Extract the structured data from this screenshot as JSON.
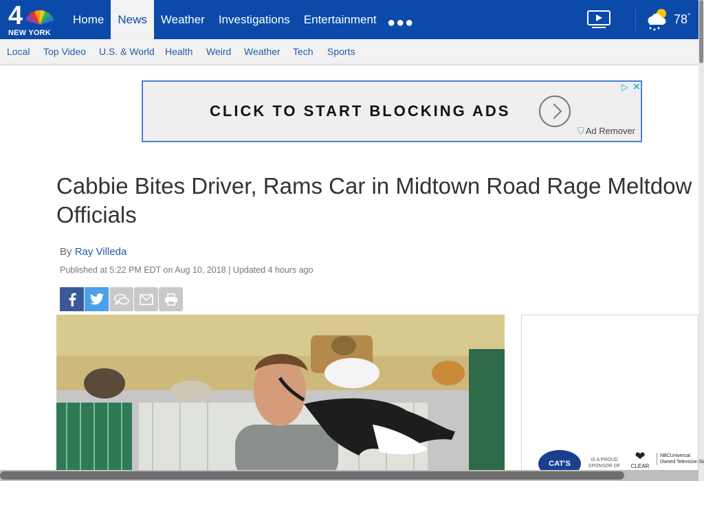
{
  "header": {
    "logo_number": "4",
    "logo_city": "NEW YORK",
    "nav": [
      "Home",
      "News",
      "Weather",
      "Investigations",
      "Entertainment"
    ],
    "active_nav": "News",
    "more_icon": "more-dots-icon",
    "video_icon": "video-play-icon",
    "weather_icon": "partly-cloudy-rain-icon",
    "temperature": "78",
    "temperature_unit": "°"
  },
  "subnav": [
    "Local",
    "Top Video",
    "U.S. & World",
    "Health",
    "Weird",
    "Weather",
    "Tech",
    "Sports"
  ],
  "ad": {
    "text": "CLICK TO START BLOCKING ADS",
    "remover_label": "Ad Remover",
    "choices_icon": "ad-choices-icon",
    "close_icon": "close-icon"
  },
  "article": {
    "headline_line1": "Cabbie Bites Driver, Rams Car in Midtown Road Rage Meltdow",
    "headline_line2": "Officials",
    "by_prefix": "By",
    "author": "Ray Villeda",
    "published": "Published at 5:22 PM EDT on Aug 10, 2018 | Updated 4 hours ago",
    "share_buttons": [
      "facebook-icon",
      "twitter-icon",
      "comments-icon",
      "email-icon",
      "print-icon"
    ]
  },
  "side_ad": {
    "brand": "CAT'S PRIDE",
    "sponsor_text": "IS A PROUD SPONSOR OF",
    "partner": "CLEAR THE SHELTERS",
    "nbc_line1": "NBCUniversal",
    "nbc_line2": "Owned Television Stations"
  },
  "colors": {
    "nav_blue": "#0b4aa8",
    "link_blue": "#1e5ba8",
    "facebook": "#3b5998",
    "twitter": "#4aa1eb"
  }
}
